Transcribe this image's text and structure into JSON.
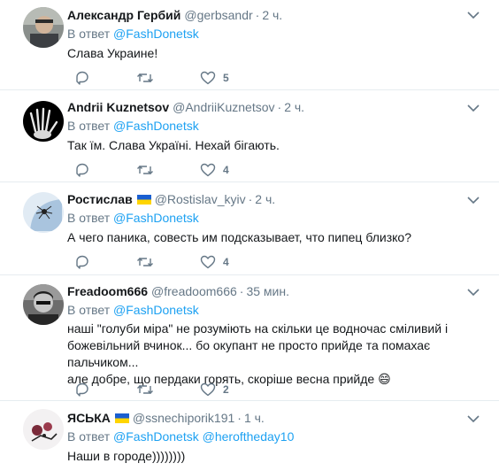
{
  "tweets": [
    {
      "name": "Александр Гербий",
      "handle": "@gerbsandr",
      "time": "2 ч.",
      "reply_prefix": "В ответ",
      "mentions": [
        "@FashDonetsk"
      ],
      "text": "Слава Украине!",
      "likes": "5",
      "flag": false
    },
    {
      "name": "Andrii Kuznetsov",
      "handle": "@AndriiKuznetsov",
      "time": "2 ч.",
      "reply_prefix": "В ответ",
      "mentions": [
        "@FashDonetsk"
      ],
      "text": "Так їм.  Слава Україні. Нехай бігають.",
      "likes": "4",
      "flag": false
    },
    {
      "name": "Ростислав",
      "handle": "@Rostislav_kyiv",
      "time": "2 ч.",
      "reply_prefix": "В ответ",
      "mentions": [
        "@FashDonetsk"
      ],
      "text": "А чего паника, совесть им  подсказывает, что пипец близко?",
      "likes": "4",
      "flag": true
    },
    {
      "name": "Freadoom666",
      "handle": "@freadoom666",
      "time": "35 мин.",
      "reply_prefix": "В ответ",
      "mentions": [
        "@FashDonetsk"
      ],
      "text_lines": [
        "наші \"голуби міра\" не розуміють на скільки це водночас сміливий і",
        "божевільний вчинок... бо окупант не просто прийде та помахає пальчиком...",
        "але добре, що пердаки горять, скоріше весна прийде 😄"
      ],
      "likes": "2",
      "flag": false
    },
    {
      "name": "ЯСЬКА",
      "handle": "@ssnechiporik191",
      "time": "1 ч.",
      "reply_prefix": "В ответ",
      "mentions": [
        "@FashDonetsk",
        "@heroftheday10"
      ],
      "text": "Наши в городе))))))))",
      "flag": true
    }
  ],
  "icons": {
    "reply": "reply-icon",
    "retweet": "retweet-icon",
    "like": "heart-icon",
    "menu": "chevron-down-icon"
  },
  "colors": {
    "link": "#1da1f2",
    "secondary": "#657786",
    "text": "#14171a",
    "divider": "#e6ecf0",
    "flag_blue": "#1a5fd1",
    "flag_yellow": "#ffd500"
  }
}
